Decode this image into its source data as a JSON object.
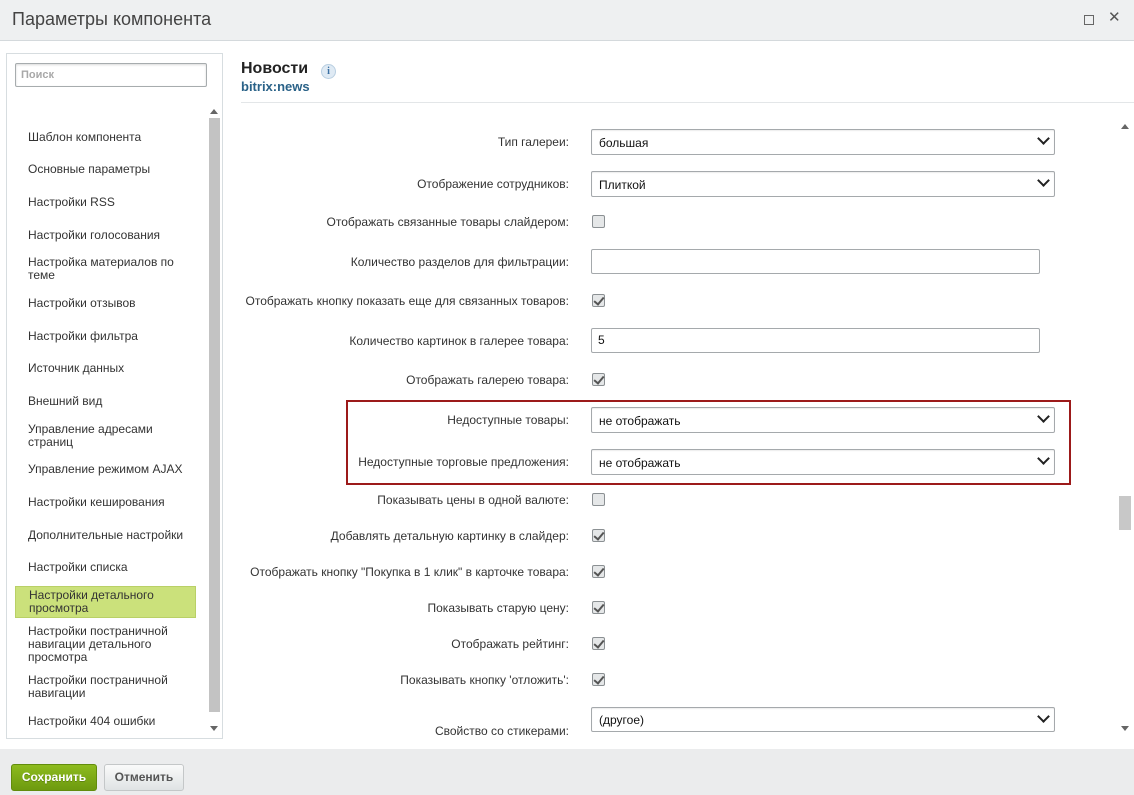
{
  "window": {
    "title": "Параметры компонента"
  },
  "search": {
    "placeholder": "Поиск"
  },
  "sidebar": {
    "items": [
      {
        "label": "Шаблон компонента"
      },
      {
        "label": "Основные параметры"
      },
      {
        "label": "Настройки RSS"
      },
      {
        "label": "Настройки голосования"
      },
      {
        "label": "Настройка материалов по теме"
      },
      {
        "label": "Настройки отзывов"
      },
      {
        "label": "Настройки фильтра"
      },
      {
        "label": "Источник данных"
      },
      {
        "label": "Внешний вид"
      },
      {
        "label": "Управление адресами страниц"
      },
      {
        "label": "Управление режимом AJAX"
      },
      {
        "label": "Настройки кеширования"
      },
      {
        "label": "Дополнительные настройки"
      },
      {
        "label": "Настройки списка"
      },
      {
        "label": "Настройки детального просмотра",
        "active": true
      },
      {
        "label": "Настройки постраничной навигации детального просмотра"
      },
      {
        "label": "Настройки постраничной навигации"
      },
      {
        "label": "Настройки 404 ошибки"
      }
    ]
  },
  "component": {
    "name": "Новости",
    "code": "bitrix:news",
    "info_icon": "i"
  },
  "params": [
    {
      "label": "Тип галереи:",
      "type": "select",
      "value": "большая"
    },
    {
      "label": "Отображение сотрудников:",
      "type": "select",
      "value": "Плиткой"
    },
    {
      "label": "Отображать связанные товары слайдером:",
      "type": "checkbox",
      "checked": false
    },
    {
      "label": "Количество разделов для фильтрации:",
      "type": "text",
      "value": ""
    },
    {
      "label": "Отображать кнопку показать еще для связанных товаров:",
      "type": "checkbox",
      "checked": true
    },
    {
      "label": "Количество картинок в галерее товара:",
      "type": "text",
      "value": "5"
    },
    {
      "label": "Отображать галерею товара:",
      "type": "checkbox",
      "checked": true
    },
    {
      "label": "Недоступные товары:",
      "type": "select",
      "value": "не отображать"
    },
    {
      "label": "Недоступные торговые предложения:",
      "type": "select",
      "value": "не отображать"
    },
    {
      "label": "Показывать цены в одной валюте:",
      "type": "checkbox",
      "checked": false
    },
    {
      "label": "Добавлять детальную картинку в слайдер:",
      "type": "checkbox",
      "checked": true
    },
    {
      "label": "Отображать кнопку \"Покупка в 1 клик\" в карточке товара:",
      "type": "checkbox",
      "checked": true
    },
    {
      "label": "Показывать старую цену:",
      "type": "checkbox",
      "checked": true
    },
    {
      "label": "Отображать рейтинг:",
      "type": "checkbox",
      "checked": true
    },
    {
      "label": "Показывать кнопку 'отложить':",
      "type": "checkbox",
      "checked": true
    },
    {
      "label": "Свойство со стикерами:",
      "type": "select",
      "value": "(другое)"
    }
  ],
  "footer": {
    "save_label": "Сохранить",
    "cancel_label": "Отменить"
  },
  "colors": {
    "accent_green": "#8dbb1e",
    "active_item": "#cbe17b",
    "highlight_border": "#9c1a1a",
    "link_blue": "#2a6288"
  }
}
